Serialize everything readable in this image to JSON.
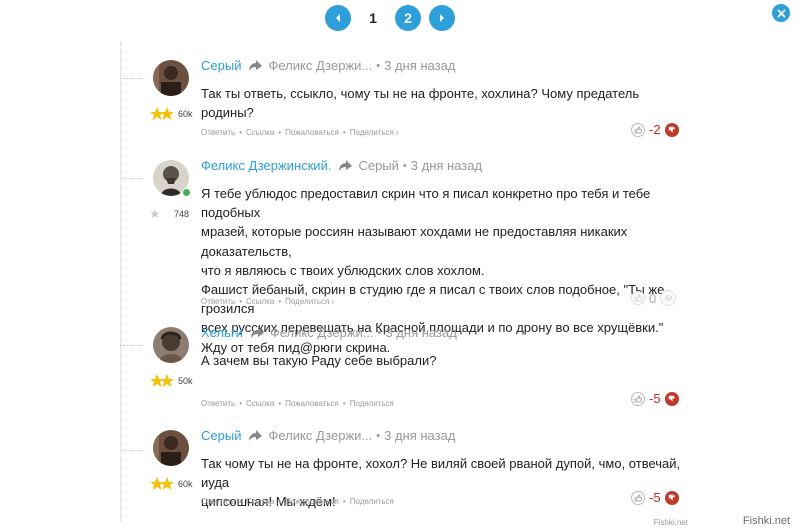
{
  "pagination": {
    "current": "1",
    "next": "2"
  },
  "comments": [
    {
      "author": "Серый",
      "reply_to": "Феликс Дзержи...",
      "time": "3 дня назад",
      "rank_score": "60k",
      "text": "Так ты ответь, ссыкло, чому ты не на фронте, хохлина? Чому предатель родины?",
      "actions": [
        "Ответить",
        "Ссылка",
        "Пожаловаться",
        "Поделиться"
      ],
      "score": "-2"
    },
    {
      "author": "Феликс Дзержинский.",
      "reply_to": "Серый",
      "time": "3 дня назад",
      "rank_score": "748",
      "text": "Я тебе ублюдос предоставил скрин что я писал конкретно про тебя и тебе подобных\nмразей, которые россиян называют хохдами не предоставляя никаких доказательств,\nчто я являюсь с твоих ублюдских слов хохлом.\nФашист йебаный, скрин в студию где я писал с твоих слов подобное, \"Ты же грозился\nвсех русских перевешать на Красной площади и по дрону во все хрущёвки.\"\nЖду от тебя пид@рюги скрина.",
      "actions": [
        "Ответить",
        "Ссылка",
        "Поделиться"
      ],
      "score": "0"
    },
    {
      "author": "Хельги",
      "reply_to": "Феликс Дзержи...",
      "time": "3 дня назад",
      "rank_score": "50k",
      "text": "А зачем вы такую Раду себе выбрали?",
      "actions": [
        "Ответить",
        "Ссылка",
        "Пожаловаться",
        "Поделиться"
      ],
      "score": "-5"
    },
    {
      "author": "Серый",
      "reply_to": "Феликс Дзержи...",
      "time": "3 дня назад",
      "rank_score": "60k",
      "text": "Так чому ты не на фронте, хохол? Не виляй своей рваной дупой, чмо, отвечай, иуда\nципсошная! Мы ждём!",
      "actions": [
        "Ответить",
        "Ссылка",
        "Пожаловаться",
        "Поделиться"
      ],
      "score": "-5"
    }
  ],
  "watermark": "Fishki.net",
  "colors": {
    "accent": "#2d9fd9",
    "negative": "#c62828",
    "downvote": "#c0392b"
  }
}
